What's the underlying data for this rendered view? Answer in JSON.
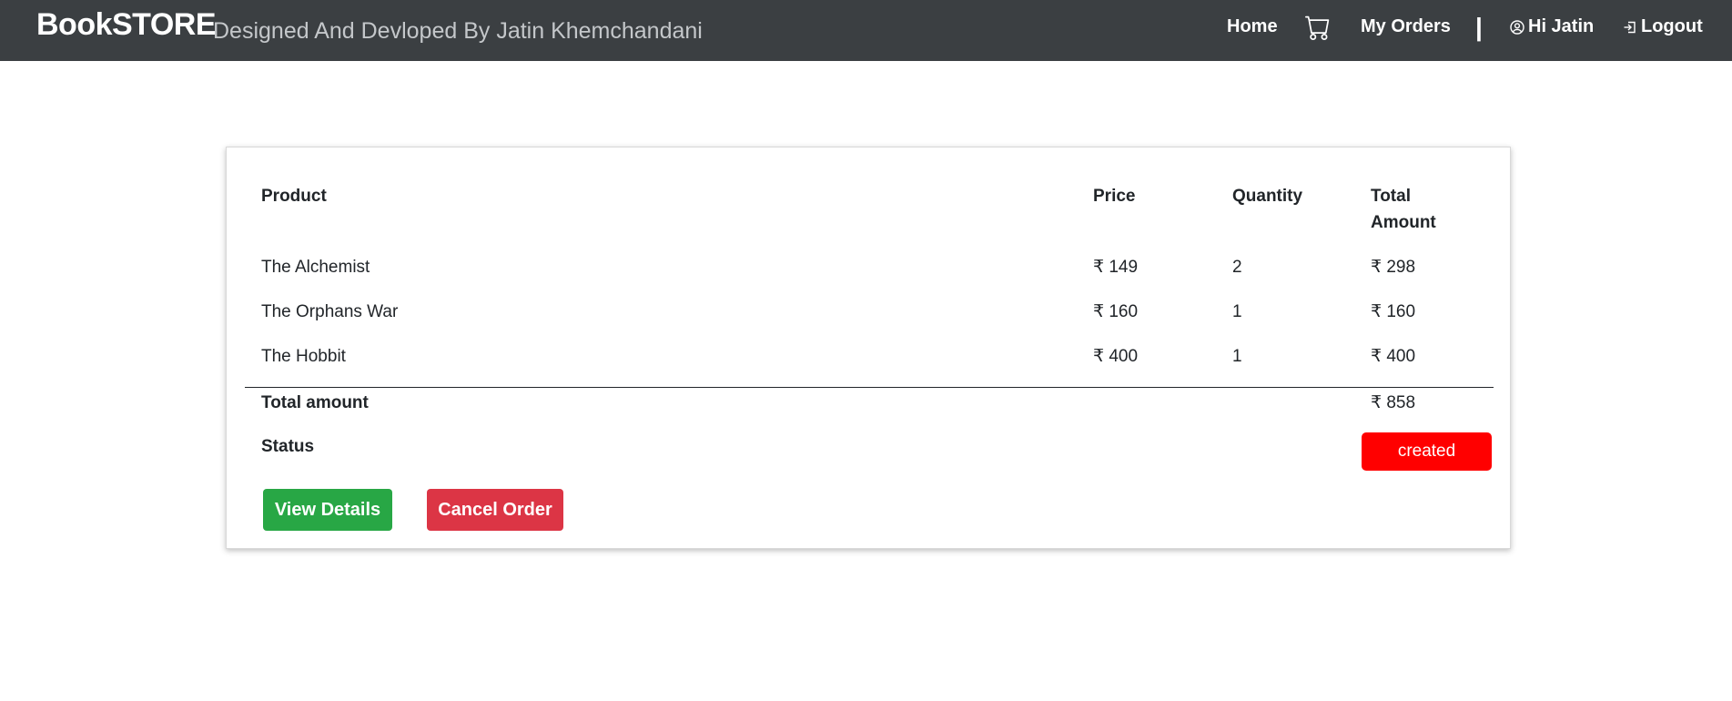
{
  "navbar": {
    "brand": "BookSTORE",
    "tagline": "Designed And Devloped By Jatin Khemchandani",
    "home": "Home",
    "cart_icon": "cart-icon",
    "my_orders": "My Orders",
    "separator": "|",
    "user_icon": "user-circle-icon",
    "user_greeting": "Hi Jatin",
    "logout_icon": "logout-icon",
    "logout": "Logout"
  },
  "order": {
    "headers": {
      "product": "Product",
      "price": "Price",
      "quantity": "Quantity",
      "total_line1": "Total",
      "total_line2": "Amount"
    },
    "items": [
      {
        "product": "The Alchemist",
        "price": "₹ 149",
        "quantity": "2",
        "total": "₹ 298"
      },
      {
        "product": "The Orphans War",
        "price": "₹ 160",
        "quantity": "1",
        "total": "₹ 160"
      },
      {
        "product": "The Hobbit",
        "price": "₹ 400",
        "quantity": "1",
        "total": "₹ 400"
      }
    ],
    "total_label": "Total amount",
    "total_value": "₹ 858",
    "status_label": "Status",
    "status_value": "created",
    "view_details": "View Details",
    "cancel_order": "Cancel Order"
  },
  "colors": {
    "navbar_bg": "#3b3f42",
    "success": "#28a745",
    "danger": "#dc3545",
    "status_badge": "#ff0000"
  }
}
